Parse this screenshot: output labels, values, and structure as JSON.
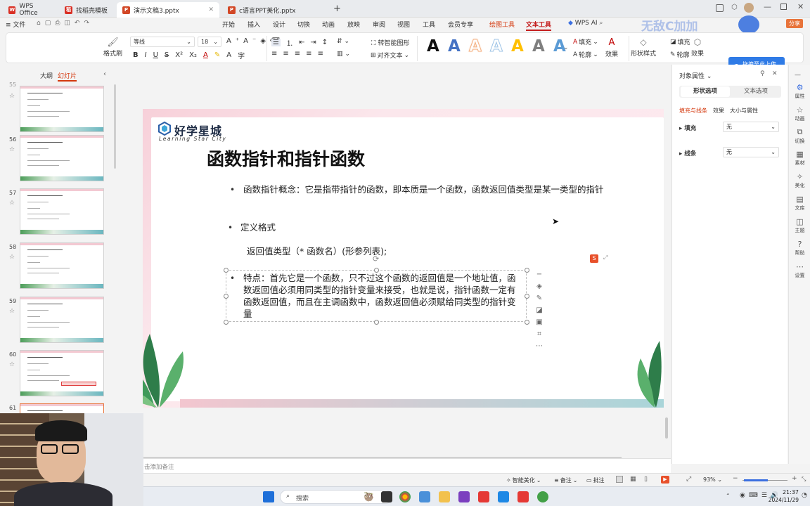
{
  "tabs": [
    {
      "label": "WPS Office",
      "color": "#d93025"
    },
    {
      "label": "找稻壳模板",
      "color": "#d93025"
    },
    {
      "label": "演示文稿3.pptx",
      "color": "#d24726"
    },
    {
      "label": "c语言PPT美化.pptx",
      "color": "#d24726"
    }
  ],
  "tabbar": {
    "new_tab": "+",
    "wps_ai": "WPS AI",
    "share": "分享",
    "login_overlay": "无敌C加加"
  },
  "menu": {
    "file": "文件",
    "items": [
      "开始",
      "插入",
      "设计",
      "切换",
      "动画",
      "放映",
      "审阅",
      "视图",
      "工具",
      "会员专享"
    ],
    "drawing_tools": "绘图工具",
    "text_tools": "文本工具",
    "wps_ai": "WPS AI"
  },
  "ribbon": {
    "format_painter": "格式刷",
    "font_name": "等线",
    "font_size": "18",
    "bold": "B",
    "italic": "I",
    "underline": "U",
    "strike": "S",
    "smart_shape": "转智能图形",
    "text_align": "对齐文本",
    "fill": "填充",
    "outline": "轮廓",
    "effect": "效果",
    "shape_style": "形状样式",
    "shape_fill": "填充",
    "shape_outline": "轮廓",
    "shape_effect": "效果",
    "text_styles": [
      "A",
      "A",
      "A",
      "A",
      "A",
      "A",
      "A"
    ],
    "text_style_colors": [
      "#111111",
      "#4472c4",
      "#f4b183",
      "#9dc3e6",
      "#ffc000",
      "#7f7f7f",
      "#5b9bd5"
    ]
  },
  "upload_badge": "拖拽至此上传",
  "left_panel": {
    "tab_outline": "大纲",
    "tab_slides": "幻灯片",
    "slides": [
      {
        "num": "55"
      },
      {
        "num": "56"
      },
      {
        "num": "57"
      },
      {
        "num": "58"
      },
      {
        "num": "59"
      },
      {
        "num": "60"
      },
      {
        "num": "61"
      }
    ]
  },
  "slide": {
    "logo_cn": "好学星城",
    "logo_en": "Learning Star City",
    "title": "函数指针和指针函数",
    "bullet1": "函数指针概念：它是指带指针的函数，即本质是一个函数，函数返回值类型是某一类型的指针",
    "bullet2": "定义格式",
    "syntax": "返回值类型（* 函数名）(形参列表);",
    "bullet3": "特点：首先它是一个函数，只不过这个函数的返回值是一个地址值，函数返回值必须用同类型的指针变量来接受，也就是说，指针函数一定有函数返回值，而且在主调函数中，函数返回值必须赋给同类型的指针变量"
  },
  "right_panel": {
    "title": "对象属性",
    "tab_shape": "形状选项",
    "tab_text": "文本选项",
    "subtabs": [
      "填充与线条",
      "效果",
      "大小与属性"
    ],
    "fill_label": "填充",
    "fill_value": "无",
    "line_label": "线条",
    "line_value": "无"
  },
  "right_bar": [
    "属性",
    "动画",
    "切换",
    "素材",
    "美化",
    "文库",
    "主题",
    "帮助",
    "设置"
  ],
  "notes_placeholder": "击添加备注",
  "status": {
    "smart_beautify": "智能美化",
    "notes": "备注",
    "comment": "批注",
    "zoom": "93%"
  },
  "taskbar": {
    "search": "搜索",
    "time": "21:37",
    "date": "2024/11/29"
  }
}
